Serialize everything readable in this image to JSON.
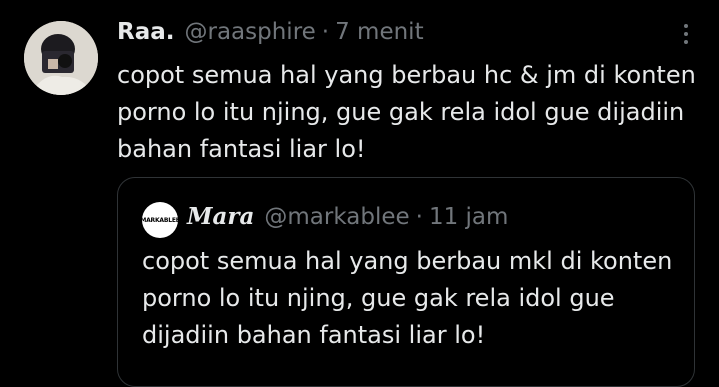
{
  "tweet": {
    "display_name": "Raa.",
    "handle": "@raasphire",
    "separator": "·",
    "time": "7 menit",
    "text": "copot semua hal yang berbau hc & jm di konten porno lo itu njing, gue gak rela idol gue dijadiin bahan fantasi liar lo!"
  },
  "quote": {
    "display_name": "Mara",
    "handle": "@markablee",
    "separator": "·",
    "time": "11 jam",
    "text": "copot semua hal yang berbau mkl di konten porno lo itu njing, gue gak rela idol gue dijadiin bahan fantasi liar lo!"
  },
  "icons": {
    "more": "more-vertical-icon"
  }
}
